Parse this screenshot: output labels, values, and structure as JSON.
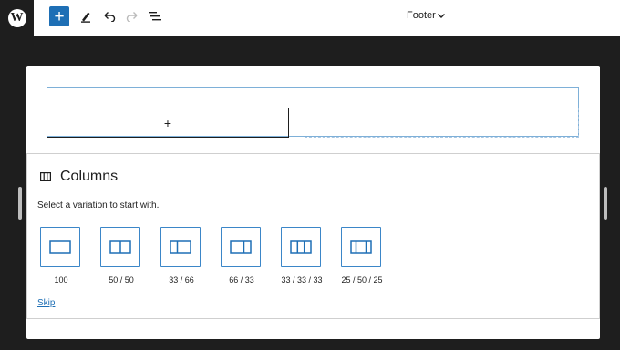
{
  "toolbar": {
    "logo_icon": "wordpress-logo",
    "add_label": "+",
    "icons": [
      "add-block-icon",
      "edit-pen-icon",
      "undo-icon",
      "redo-icon",
      "list-view-icon"
    ],
    "document_title": "Footer",
    "accent_color": "#1e6fb5"
  },
  "canvas": {
    "empty_column_placeholder": "+"
  },
  "placeholder": {
    "icon": "columns-icon",
    "title": "Columns",
    "instructions": "Select a variation to start with.",
    "variations": [
      {
        "label": "100",
        "icon": "one-column-icon"
      },
      {
        "label": "50 / 50",
        "icon": "two-columns-icon"
      },
      {
        "label": "33 / 66",
        "icon": "two-columns-33-66-icon"
      },
      {
        "label": "66 / 33",
        "icon": "two-columns-66-33-icon"
      },
      {
        "label": "33 / 33 / 33",
        "icon": "three-columns-icon"
      },
      {
        "label": "25 / 50 / 25",
        "icon": "three-columns-wide-center-icon"
      }
    ],
    "skip_label": "Skip"
  }
}
